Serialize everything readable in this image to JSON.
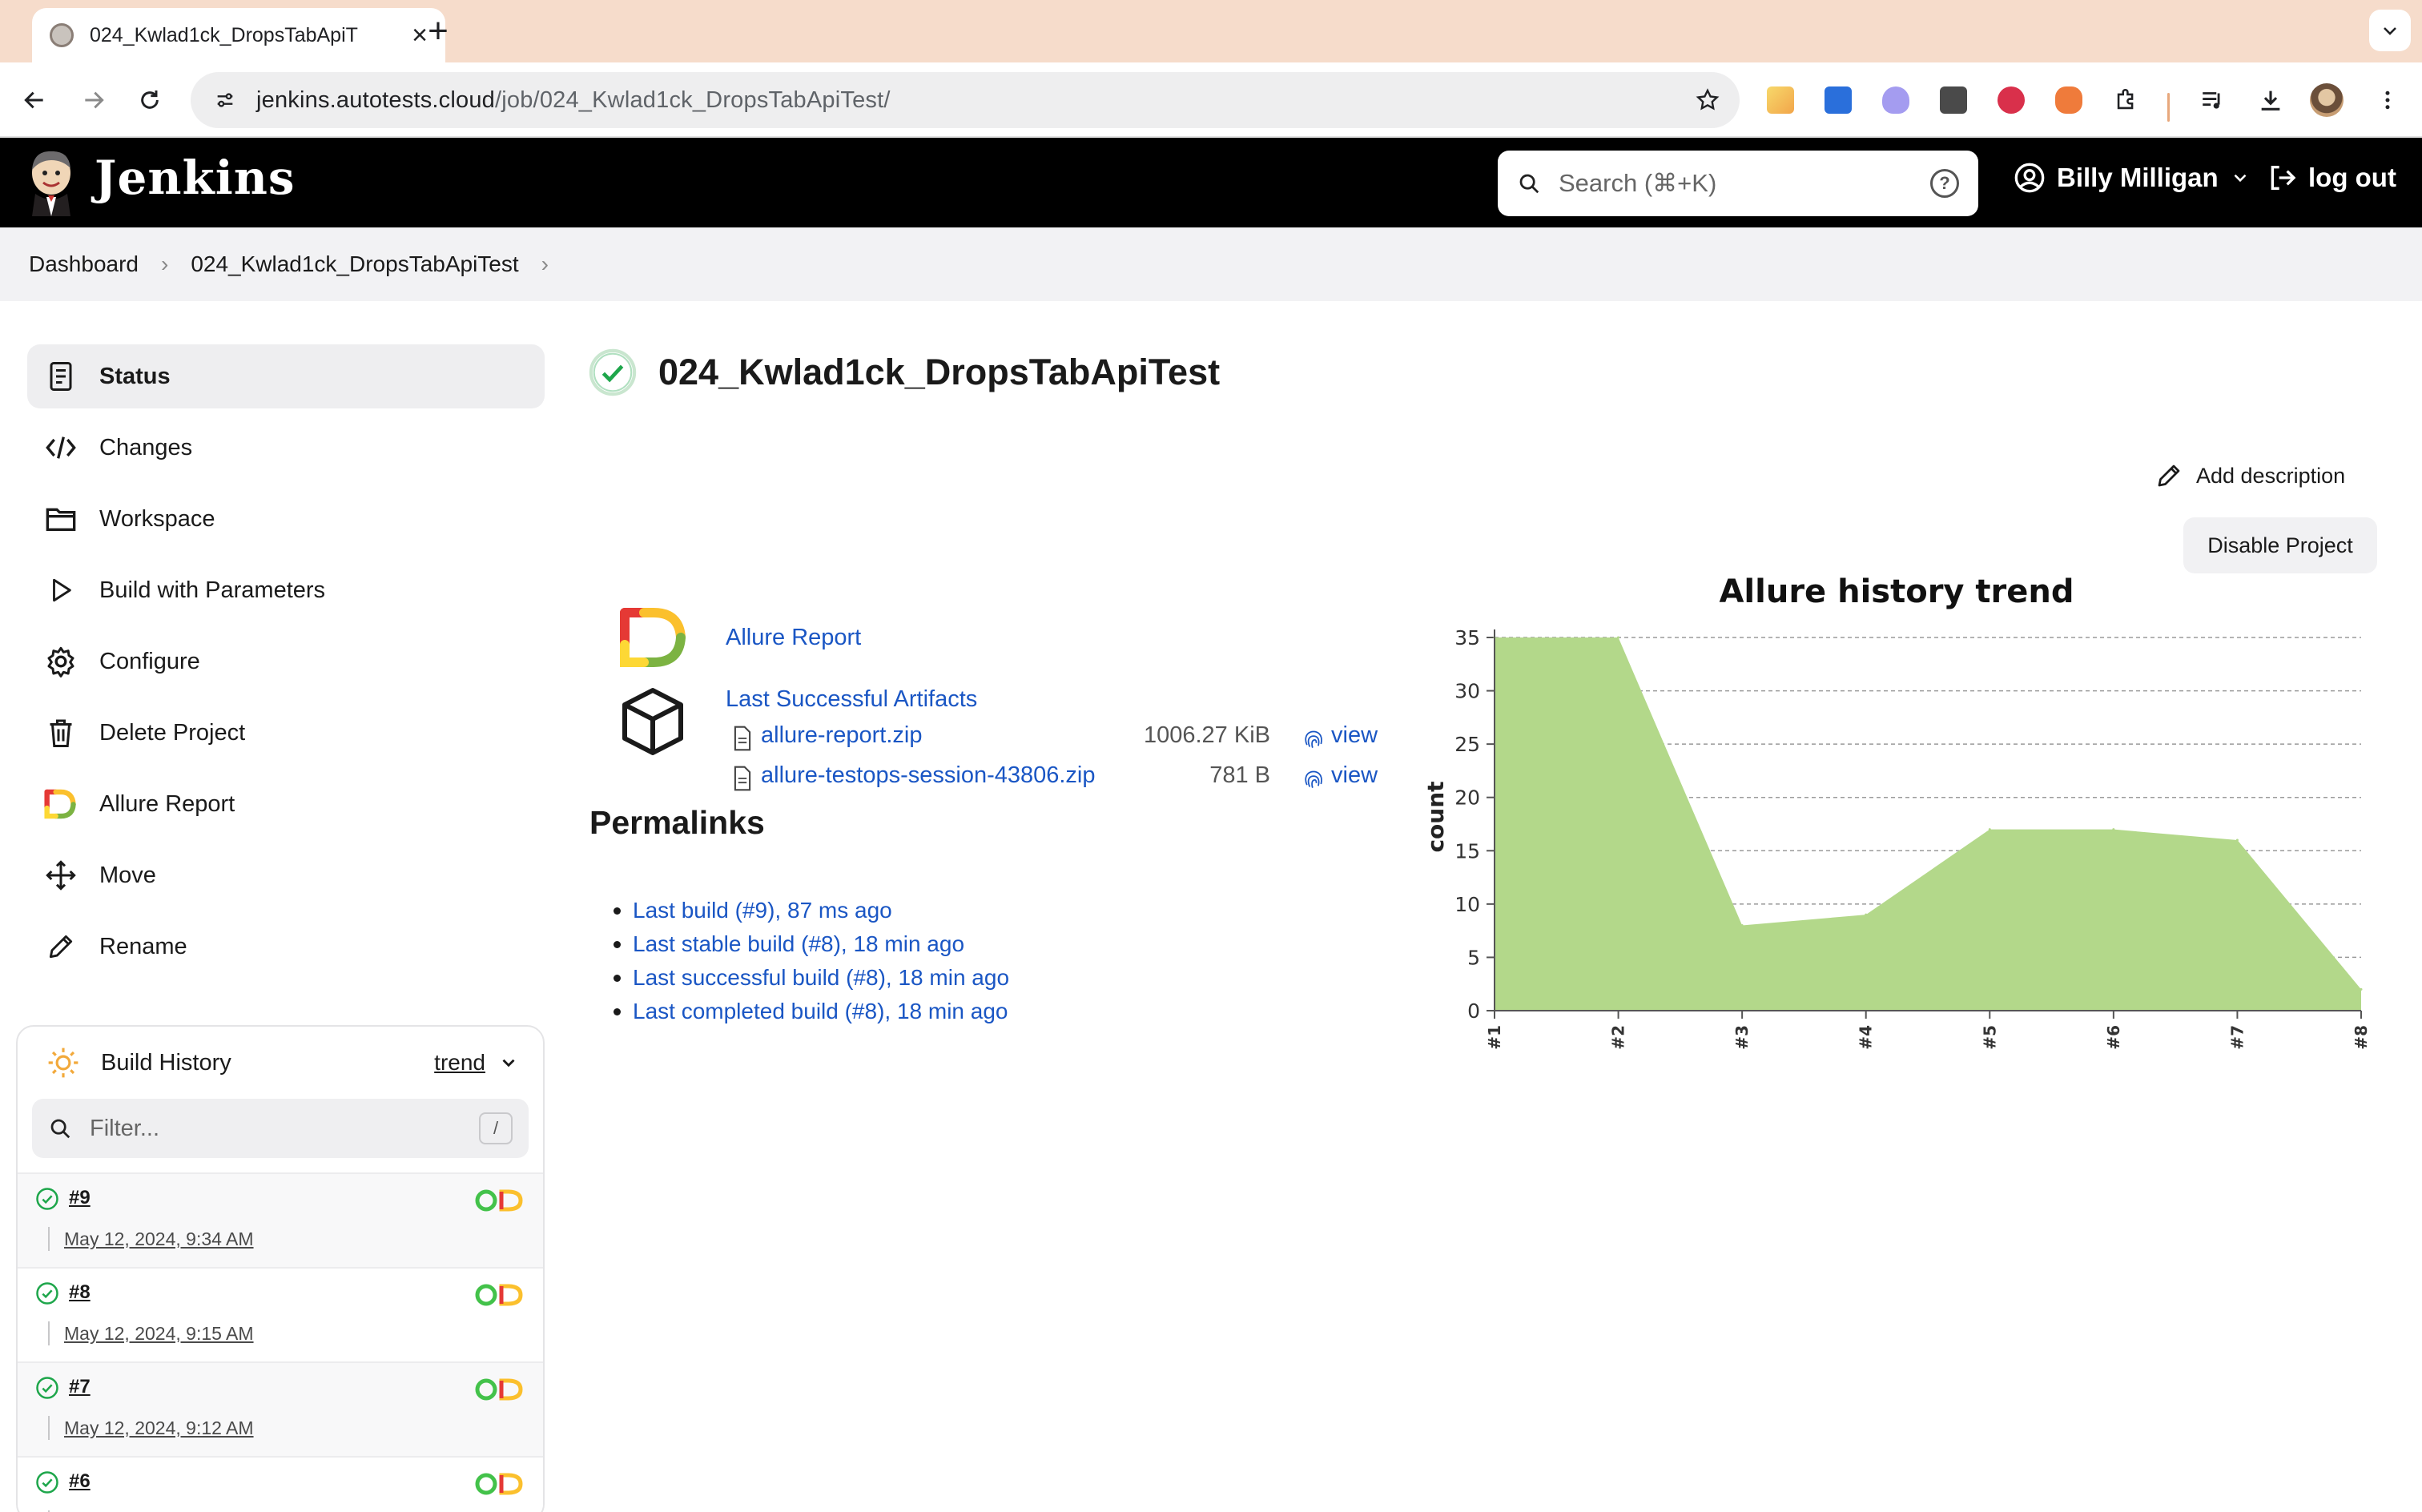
{
  "browser": {
    "tab_title": "024_Kwlad1ck_DropsTabApiT",
    "url_host": "jenkins.autotests.cloud",
    "url_path": "/job/024_Kwlad1ck_DropsTabApiTest/"
  },
  "header": {
    "brand": "Jenkins",
    "search_placeholder": "Search (⌘+K)",
    "user_name": "Billy Milligan",
    "logout_label": "log out"
  },
  "breadcrumb": [
    "Dashboard",
    "024_Kwlad1ck_DropsTabApiTest"
  ],
  "sidebar": {
    "items": [
      {
        "label": "Status",
        "icon": "status-icon"
      },
      {
        "label": "Changes",
        "icon": "code-icon"
      },
      {
        "label": "Workspace",
        "icon": "folder-icon"
      },
      {
        "label": "Build with Parameters",
        "icon": "play-icon"
      },
      {
        "label": "Configure",
        "icon": "gear-icon"
      },
      {
        "label": "Delete Project",
        "icon": "trash-icon"
      },
      {
        "label": "Allure Report",
        "icon": "allure-icon"
      },
      {
        "label": "Move",
        "icon": "move-icon"
      },
      {
        "label": "Rename",
        "icon": "pencil-icon"
      }
    ]
  },
  "build_history": {
    "title": "Build History",
    "trend_label": "trend",
    "filter_placeholder": "Filter...",
    "filter_shortcut": "/",
    "builds": [
      {
        "number": "#9",
        "date": "May 12, 2024, 9:34 AM"
      },
      {
        "number": "#8",
        "date": "May 12, 2024, 9:15 AM"
      },
      {
        "number": "#7",
        "date": "May 12, 2024, 9:12 AM"
      },
      {
        "number": "#6",
        "date": ""
      }
    ]
  },
  "main": {
    "title": "024_Kwlad1ck_DropsTabApiTest",
    "add_description": "Add description",
    "disable_project": "Disable Project",
    "allure_report_link": "Allure Report",
    "artifacts_link": "Last Successful Artifacts",
    "artifacts": [
      {
        "name": "allure-report.zip",
        "size": "1006.27 KiB",
        "view": "view"
      },
      {
        "name": "allure-testops-session-43806.zip",
        "size": "781 B",
        "view": "view"
      }
    ],
    "permalinks_heading": "Permalinks",
    "permalinks": [
      "Last build (#9), 87 ms ago",
      "Last stable build (#8), 18 min ago",
      "Last successful build (#8), 18 min ago",
      "Last completed build (#8), 18 min ago"
    ]
  },
  "colors": {
    "link": "#1a56c4",
    "success": "#1ea64b",
    "chart_fill": "#b3d88a"
  },
  "chart_data": {
    "type": "area",
    "title": "Allure history trend",
    "xlabel": "",
    "ylabel": "count",
    "categories": [
      "#1",
      "#2",
      "#3",
      "#4",
      "#5",
      "#6",
      "#7",
      "#8"
    ],
    "series": [
      {
        "values": [
          35,
          35,
          8,
          9,
          17,
          17,
          16,
          2
        ]
      }
    ],
    "ylim": [
      0,
      35
    ],
    "yticks": [
      0,
      5,
      10,
      15,
      20,
      25,
      30,
      35
    ],
    "grid": true
  }
}
